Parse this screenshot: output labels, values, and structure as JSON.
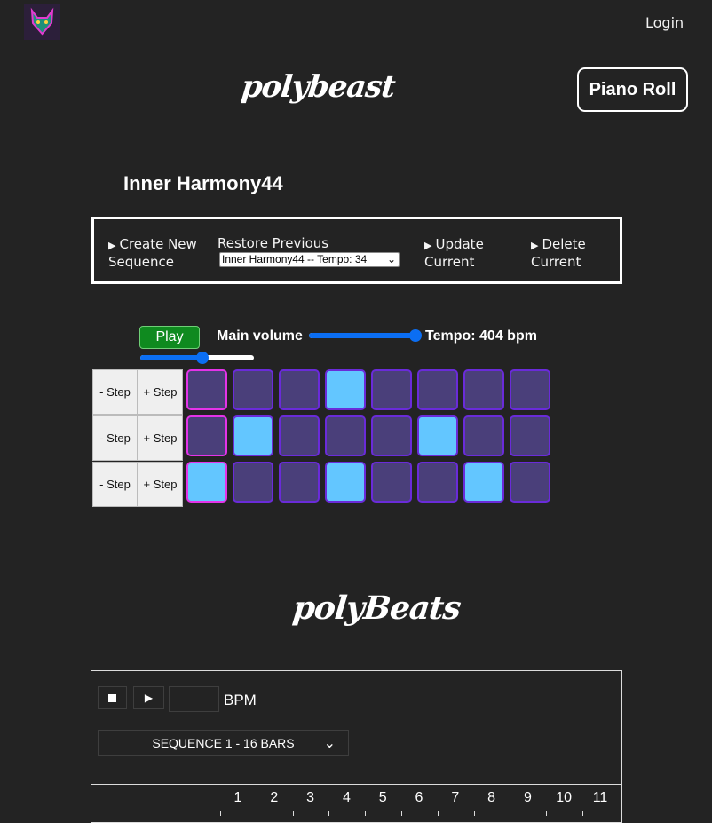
{
  "nav": {
    "login_label": "Login"
  },
  "brand": {
    "title": "polybeast",
    "piano_roll_label": "Piano Roll"
  },
  "sequence": {
    "name": "Inner Harmony44"
  },
  "controls": {
    "create_label_1": "Create New",
    "create_label_2": "Sequence",
    "restore_label": "Restore Previous",
    "restore_selected": "Inner Harmony44 -- Tempo: 34",
    "update_label_1": "Update",
    "update_label_2": "Current",
    "delete_label_1": "Delete",
    "delete_label_2": "Current"
  },
  "player": {
    "play_label": "Play",
    "volume_label": "Main volume",
    "tempo_label": "Tempo: 404 bpm",
    "volume_level": 0.98,
    "tempo_level": 0.55
  },
  "step_labels": {
    "minus": "- Step",
    "plus": "+ Step"
  },
  "grid": [
    [
      0,
      0,
      0,
      1,
      0,
      0,
      0,
      0
    ],
    [
      0,
      1,
      0,
      0,
      0,
      1,
      0,
      0
    ],
    [
      1,
      0,
      0,
      1,
      0,
      0,
      1,
      0
    ]
  ],
  "beats": {
    "title": "polyBeats",
    "stop_icon": "stop-icon",
    "play_icon": "play-icon",
    "bpm_value": "",
    "bpm_label": "BPM",
    "sequence_selected": "SEQUENCE 1 - 16 BARS",
    "columns": [
      "1",
      "2",
      "3",
      "4",
      "5",
      "6",
      "7",
      "8",
      "9",
      "10",
      "11"
    ]
  },
  "colors": {
    "background": "#232323",
    "cell_off": "#4a3f7a",
    "cell_on": "#63c6ff",
    "cell_border": "#6a2bd9",
    "cell_border_active": "#e433e8",
    "play_green": "#0f8a1f",
    "slider_blue": "#0b6ef3"
  }
}
